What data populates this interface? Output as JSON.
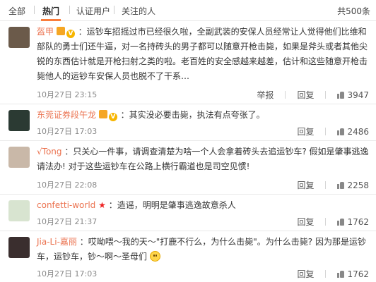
{
  "tabs": {
    "all": "全部",
    "hot": "热门",
    "verified": "认证用户",
    "following": "关注的人"
  },
  "total_count": "共500条",
  "comments": [
    {
      "user": "盔甲",
      "text": "：运钞车招摇过市已经很久啦，全副武装的安保人员经常让人觉得他们比维和部队的勇士们还牛逼，对一名持砖头的男子都可以随意开枪击毙，如果是斧头或者其他尖锐的东西估计就是开枪扫射之类的啦。老百姓的安全感越来越差，估计和这些随意开枪击毙他人的运钞车安保人员也脱不了干系…",
      "time": "10月27日 23:15",
      "report": "举报",
      "reply": "回复",
      "likes": "3947",
      "avatar_color": "#6b5a4a"
    },
    {
      "user": "东莞证券段午龙",
      "text": "：其实没必要击毙，执法有点夸张了。",
      "time": "10月27日 17:03",
      "reply": "回复",
      "likes": "2486",
      "avatar_color": "#2b3a33"
    },
    {
      "user": "√Tong",
      "text": "：只关心一件事，请调查清楚为啥一个人会拿着砖头去追运钞车? 假如是肇事逃逸请法办! 对于这些运钞车在公路上横行霸道也是司空见惯!",
      "time": "10月27日 22:08",
      "reply": "回复",
      "likes": "2258",
      "avatar_color": "#c9b8a8"
    },
    {
      "user": "confetti-world",
      "text": "：造谣，明明是肇事逃逸故意杀人",
      "time": "10月27日 21:37",
      "reply": "回复",
      "likes": "1762",
      "avatar_color": "#d8e4d0"
    },
    {
      "user": "Jia-Li-嘉丽",
      "text": "：哎呦喂～我的天～\"打鹿不行么，为什么击毙\"。为什么击毙? 因为那是运钞车，运钞车，钞～啊～圣母们",
      "time": "10月27日 17:03",
      "reply": "回复",
      "likes": "1762",
      "avatar_color": "#3a2e2e"
    }
  ],
  "colors": {
    "accent": "#fa7d3c",
    "username": "#eb7350",
    "meta": "#888888"
  }
}
